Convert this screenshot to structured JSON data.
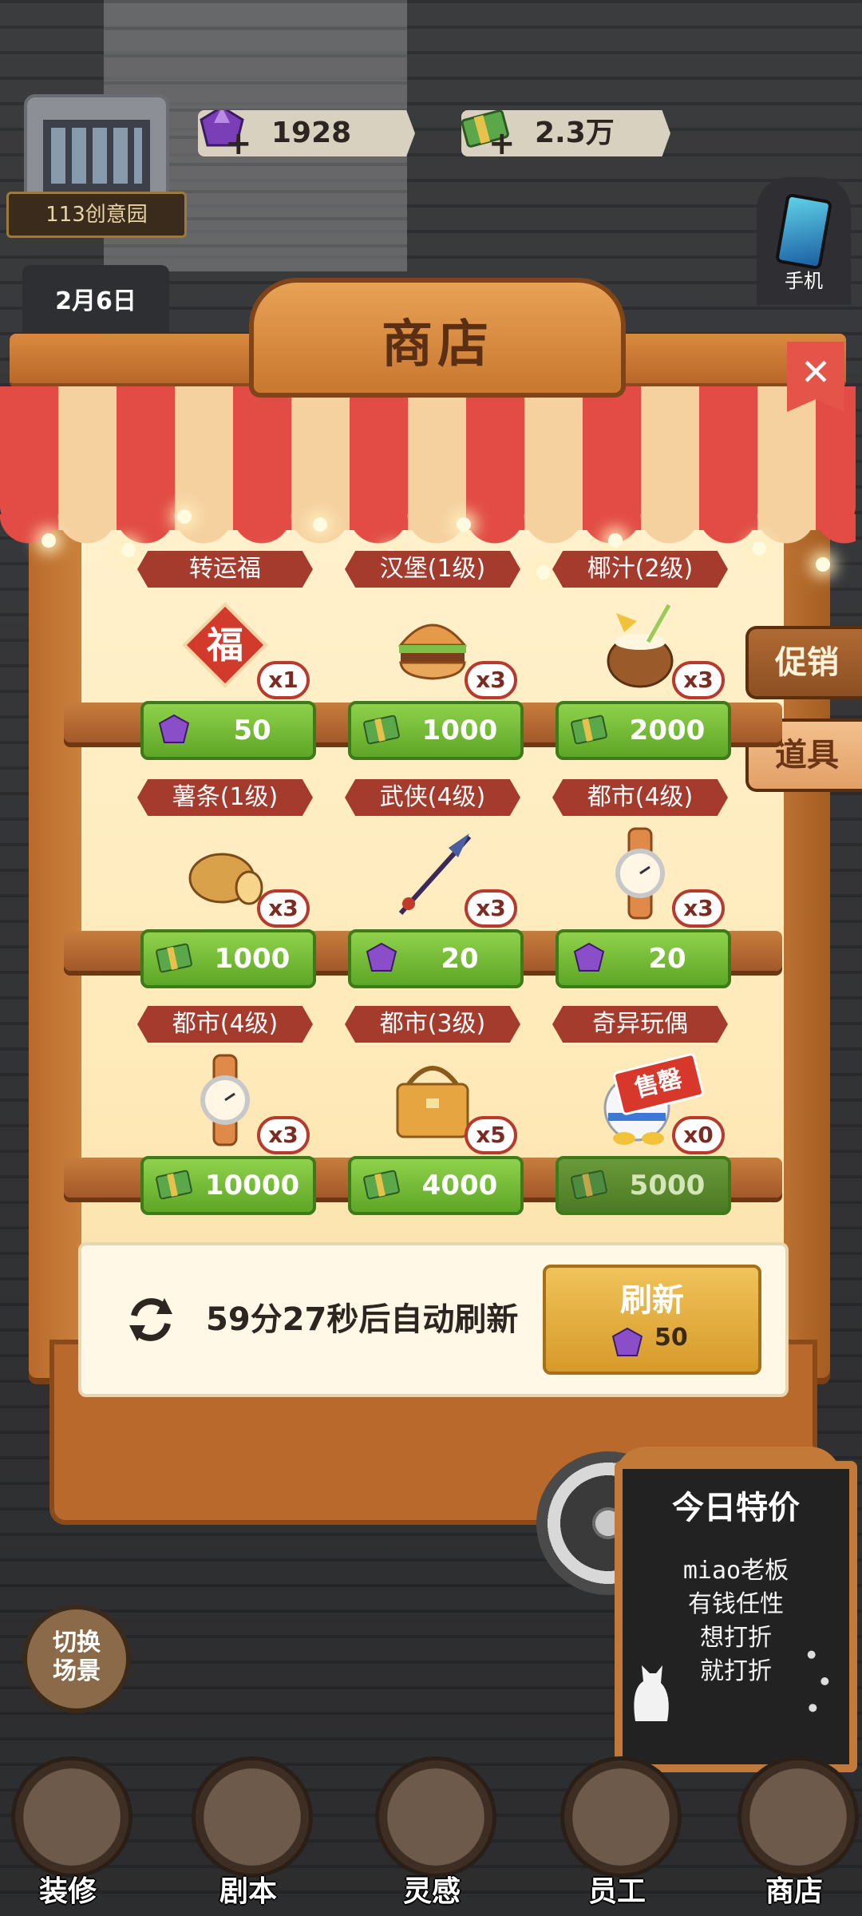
{
  "hud": {
    "location": "113创意园",
    "date": "2月6日",
    "gems": "1928",
    "cash": "2.3万",
    "phone_label": "手机"
  },
  "shop": {
    "title": "商店",
    "close": "✕",
    "tabs": [
      "促销",
      "道具"
    ],
    "items": [
      {
        "name": "转运福",
        "qty": "x1",
        "currency": "gem",
        "price": "50"
      },
      {
        "name": "汉堡(1级)",
        "qty": "x3",
        "currency": "cash",
        "price": "1000"
      },
      {
        "name": "椰汁(2级)",
        "qty": "x3",
        "currency": "cash",
        "price": "2000"
      },
      {
        "name": "薯条(1级)",
        "qty": "x3",
        "currency": "cash",
        "price": "1000"
      },
      {
        "name": "武侠(4级)",
        "qty": "x3",
        "currency": "gem",
        "price": "20"
      },
      {
        "name": "都市(4级)",
        "qty": "x3",
        "currency": "gem",
        "price": "20"
      },
      {
        "name": "都市(4级)",
        "qty": "x3",
        "currency": "cash",
        "price": "10000"
      },
      {
        "name": "都市(3级)",
        "qty": "x5",
        "currency": "cash",
        "price": "4000"
      },
      {
        "name": "奇异玩偶",
        "qty": "x0",
        "currency": "cash",
        "price": "5000",
        "sold_out": "售罄"
      }
    ],
    "refresh": {
      "timer_text": "59分27秒后自动刷新",
      "button_label": "刷新",
      "cost": "50"
    }
  },
  "board": {
    "title": "今日特价",
    "lines": [
      "miao老板",
      "有钱任性",
      "想打折",
      "就打折"
    ]
  },
  "nav": {
    "switch_scene": [
      "切换",
      "场景"
    ],
    "items": [
      "装修",
      "剧本",
      "灵感",
      "员工",
      "商店"
    ]
  },
  "colors": {
    "price_green": "#6fb52f",
    "name_ribbon": "#a43b2d",
    "awning_red": "#e24c44",
    "refresh_gold": "#e3ac3f"
  }
}
